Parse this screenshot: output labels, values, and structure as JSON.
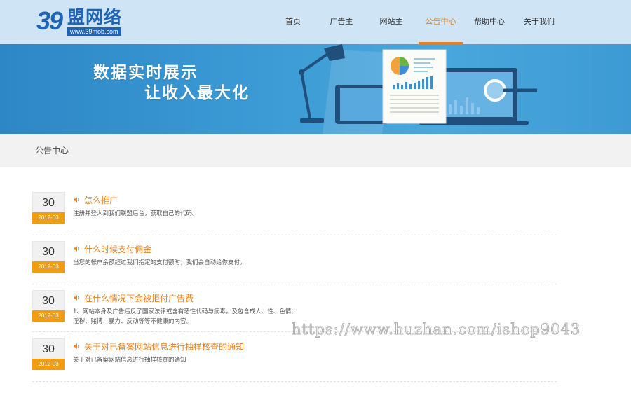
{
  "logo": {
    "number": "39",
    "name": "盟网络",
    "url": "www.39mob.com"
  },
  "nav": {
    "items": [
      {
        "label": "首页",
        "active": false
      },
      {
        "label": "广告主",
        "active": false
      },
      {
        "label": "网站主",
        "active": false
      },
      {
        "label": "公告中心",
        "active": true
      },
      {
        "label": "帮助中心",
        "active": false
      },
      {
        "label": "关于我们",
        "active": false
      }
    ],
    "active_color": "#e8811d"
  },
  "banner": {
    "line1": "数据实时展示",
    "line2": "让收入最大化"
  },
  "breadcrumb": {
    "label": "公告中心"
  },
  "notices": [
    {
      "day": "30",
      "month": "2012-03",
      "title": "怎么推广",
      "desc_lines": [
        "注册并登入到我们联盟后台，获取自己的代码。"
      ]
    },
    {
      "day": "30",
      "month": "2012-03",
      "title": "什么时候支付佣金",
      "desc_lines": [
        "当您的帐户余额超过我们指定的支付额时，我们会自动给你支付。"
      ]
    },
    {
      "day": "30",
      "month": "2012-03",
      "title": "在什么情况下会被拒付广告费",
      "desc_lines": [
        "1、网站本身及广告违反了国家法律或含有恶性代码与病毒，及包含成人、性、色情、",
        "淫秽、赌博、暴力、反动等等不健康的内容。"
      ]
    },
    {
      "day": "30",
      "month": "2012-03",
      "title": "关于对已备案网站信息进行抽样核查的通知",
      "desc_lines": [
        "关于对已备案网站信息进行抽样核查的通知"
      ]
    }
  ],
  "watermark": "https://www.huzhan.com/ishop9043",
  "colors": {
    "header_bg": "#cfe4f5",
    "banner_blue": "#3b9ad4",
    "accent_orange": "#e8811d",
    "date_orange": "#f39c12"
  },
  "icons": {
    "notice": "speaker-icon"
  }
}
